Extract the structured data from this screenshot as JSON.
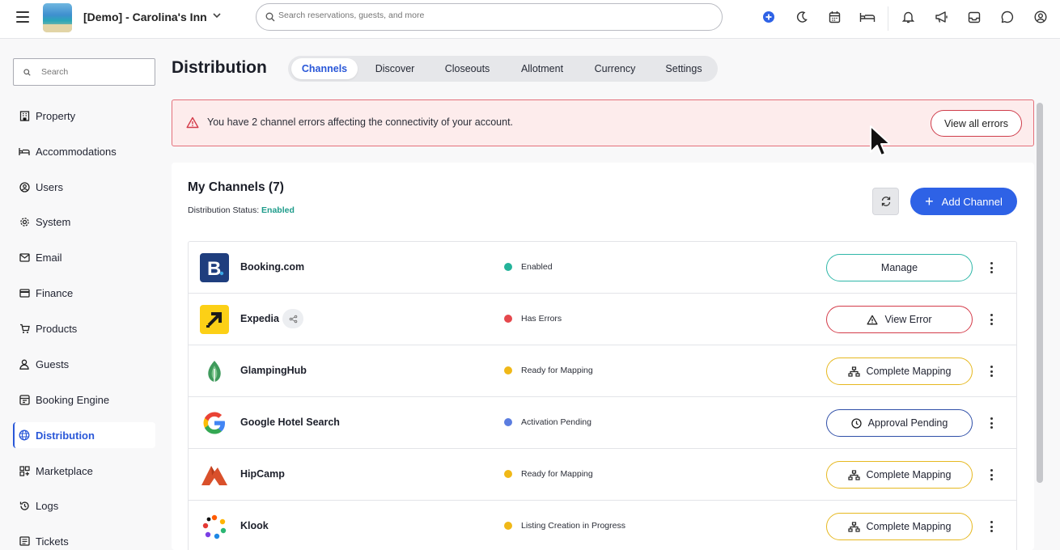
{
  "topbar": {
    "property_name": "[Demo] - Carolina's Inn",
    "search_placeholder": "Search reservations, guests, and more"
  },
  "sidebar": {
    "search_placeholder": "Search",
    "items": [
      {
        "label": "Property",
        "icon": "building-icon"
      },
      {
        "label": "Accommodations",
        "icon": "bed-icon"
      },
      {
        "label": "Users",
        "icon": "user-circle-icon"
      },
      {
        "label": "System",
        "icon": "gear-icon"
      },
      {
        "label": "Email",
        "icon": "mail-icon"
      },
      {
        "label": "Finance",
        "icon": "card-icon"
      },
      {
        "label": "Products",
        "icon": "cart-icon"
      },
      {
        "label": "Guests",
        "icon": "person-icon"
      },
      {
        "label": "Booking Engine",
        "icon": "booking-engine-icon"
      },
      {
        "label": "Distribution",
        "icon": "globe-icon",
        "active": true
      },
      {
        "label": "Marketplace",
        "icon": "grid-plus-icon"
      },
      {
        "label": "Logs",
        "icon": "history-icon"
      },
      {
        "label": "Tickets",
        "icon": "list-icon"
      }
    ]
  },
  "page": {
    "title": "Distribution",
    "tabs": [
      "Channels",
      "Discover",
      "Closeouts",
      "Allotment",
      "Currency",
      "Settings"
    ],
    "active_tab": "Channels"
  },
  "alert": {
    "message": "You have 2 channel errors affecting the connectivity of your account.",
    "button": "View all errors"
  },
  "channels_card": {
    "title": "My Channels (7)",
    "status_label": "Distribution Status:",
    "status_value": "Enabled",
    "add_button": "Add Channel",
    "rows": [
      {
        "name": "Booking.com",
        "status": "Enabled",
        "status_color": "#24b39a",
        "action": "Manage",
        "action_icon": "",
        "border": "#2fb7a8"
      },
      {
        "name": "Expedia",
        "status": "Has Errors",
        "status_color": "#e5484d",
        "action": "View Error",
        "action_icon": "warning-icon",
        "border": "#d43c4a"
      },
      {
        "name": "GlampingHub",
        "status": "Ready for Mapping",
        "status_color": "#f0b818",
        "action": "Complete Mapping",
        "action_icon": "hierarchy-icon",
        "border": "#e6b820"
      },
      {
        "name": "Google Hotel Search",
        "status": "Activation Pending",
        "status_color": "#5b7de0",
        "action": "Approval Pending",
        "action_icon": "clock-icon",
        "border": "#2f4fa8"
      },
      {
        "name": "HipCamp",
        "status": "Ready for Mapping",
        "status_color": "#f0b818",
        "action": "Complete Mapping",
        "action_icon": "hierarchy-icon",
        "border": "#e6b820"
      },
      {
        "name": "Klook",
        "status": "Listing Creation in Progress",
        "status_color": "#f0b818",
        "action": "Complete Mapping",
        "action_icon": "hierarchy-icon",
        "border": "#e6b820"
      }
    ]
  }
}
